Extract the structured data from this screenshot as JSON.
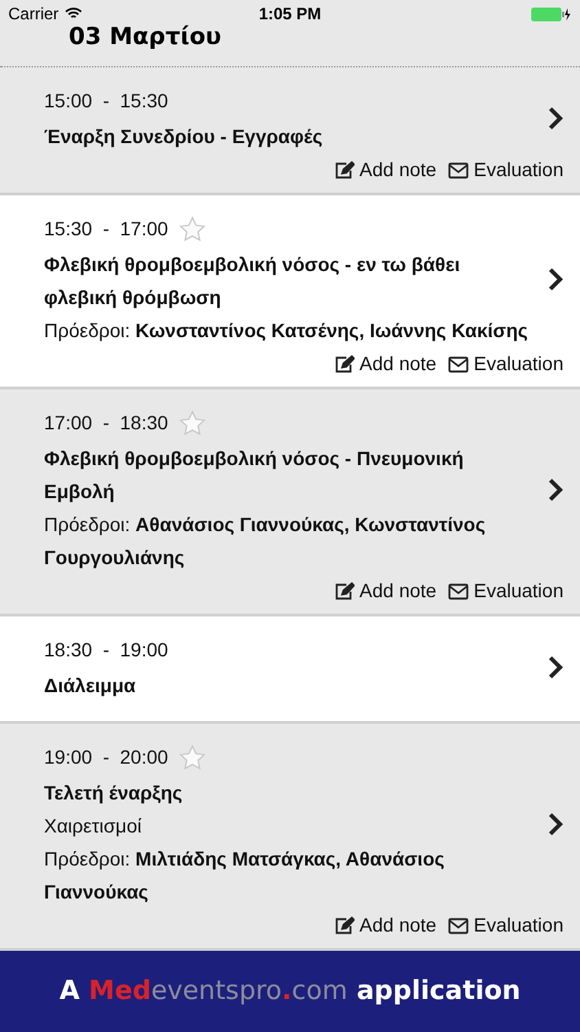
{
  "status_bar": {
    "carrier": "Carrier",
    "time": "1:05 PM"
  },
  "header": {
    "title": "03 Μαρτίου"
  },
  "sessions": [
    {
      "start": "15:00",
      "sep": "-",
      "end": "15:30",
      "title": "Έναρξη Συνεδρίου - Εγγραφές",
      "actions": [
        {
          "kind": "note",
          "label": "Add note"
        },
        {
          "kind": "mail",
          "label": "Evaluation"
        }
      ]
    },
    {
      "start": "15:30",
      "sep": "-",
      "end": "17:00",
      "favorite": false,
      "title": "Φλεβική θρομβοεμβολική νόσος - εν τω βάθει φλεβική θρόμβωση",
      "chairs": {
        "label": "Πρόεδροι:",
        "names": "Κωνσταντίνος Κατσένης, Ιωάννης Κακίσης"
      },
      "actions": [
        {
          "kind": "note",
          "label": "Add note"
        },
        {
          "kind": "mail",
          "label": "Evaluation"
        }
      ]
    },
    {
      "start": "17:00",
      "sep": "-",
      "end": "18:30",
      "favorite": false,
      "title": "Φλεβική θρομβοεμβολική νόσος - Πνευμονική Εμβολή",
      "chairs": {
        "label": "Πρόεδροι:",
        "names": "Αθανάσιος Γιαννούκας, Κωνσταντίνος Γουργουλιάνης"
      },
      "actions": [
        {
          "kind": "note",
          "label": "Add note"
        },
        {
          "kind": "mail",
          "label": "Evaluation"
        }
      ]
    },
    {
      "start": "18:30",
      "sep": "-",
      "end": "19:00",
      "title": "Διάλειμμα"
    },
    {
      "start": "19:00",
      "sep": "-",
      "end": "20:00",
      "favorite": false,
      "title": "Τελετή έναρξης",
      "subtitle": "Χαιρετισμοί",
      "chairs": {
        "label": "Πρόεδροι:",
        "names": "Μιλτιάδης Ματσάγκας, Αθανάσιος Γιαννούκας"
      },
      "actions": [
        {
          "kind": "note",
          "label": "Add note"
        },
        {
          "kind": "mail",
          "label": "Evaluation"
        }
      ]
    }
  ],
  "footer": {
    "parts": [
      {
        "text": "A",
        "color": "#ffffff"
      },
      {
        "text": "Med",
        "color": "#d8222a"
      },
      {
        "text": "events",
        "color": "#8c8c9c"
      },
      {
        "text": "pro",
        "color": "#8c8c9c"
      },
      {
        "text": ".",
        "color": "#d8222a"
      },
      {
        "text": "com",
        "color": "#8c8c9c"
      },
      {
        "text": "application",
        "color": "#ffffff"
      }
    ]
  }
}
